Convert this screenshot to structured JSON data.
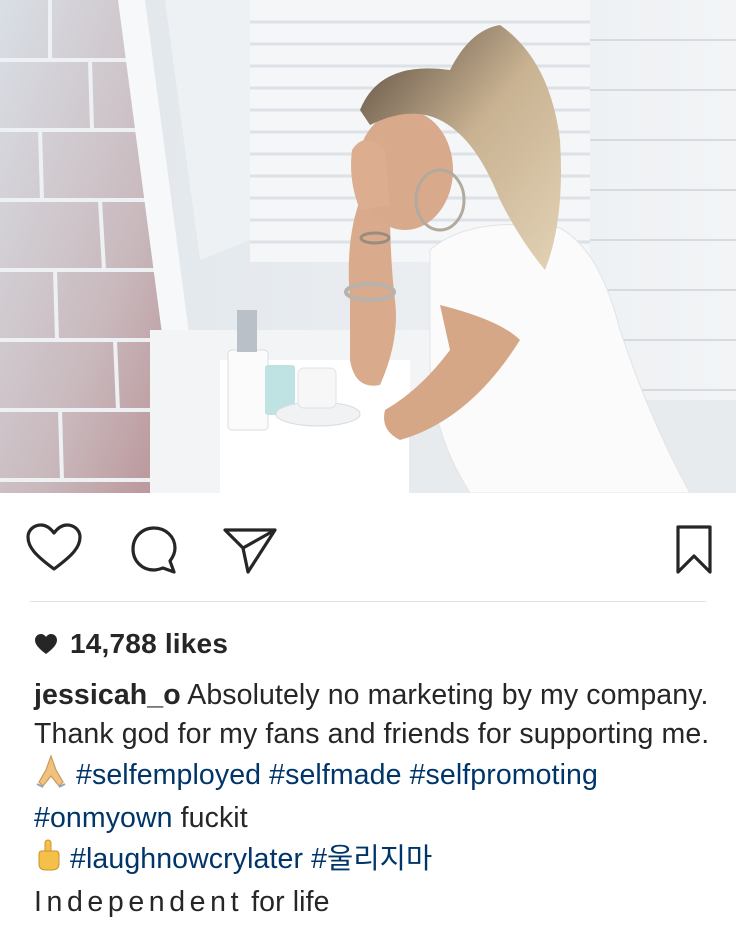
{
  "photo": {
    "alt_subject": "post-photo"
  },
  "actions": {
    "like_icon": "heart-outline-icon",
    "comment_icon": "comment-bubble-icon",
    "share_icon": "paper-plane-icon",
    "save_icon": "bookmark-outline-icon"
  },
  "likes": {
    "icon": "heart-filled-icon",
    "text": "14,788 likes"
  },
  "caption": {
    "username": "jessicah_o",
    "text_1": " Absolutely no marketing by my company. Thank god for my fans and friends for supporting me. ",
    "emoji_1": "🙏",
    "hashtag_1": "#selfemployed",
    "hashtag_2": "#selfmade",
    "hashtag_3": "#selfpromoting",
    "hashtag_4": "#onmyown",
    "text_2": " fuckit",
    "emoji_2": "🖕",
    "hashtag_5": "#laughnowcrylater",
    "hashtag_6": "#울리지마",
    "line_last_spaced": "Independent",
    "line_last_rest": "for life"
  },
  "colors": {
    "text": "#262626",
    "hashtag": "#003569",
    "divider": "#e3e3e3"
  }
}
